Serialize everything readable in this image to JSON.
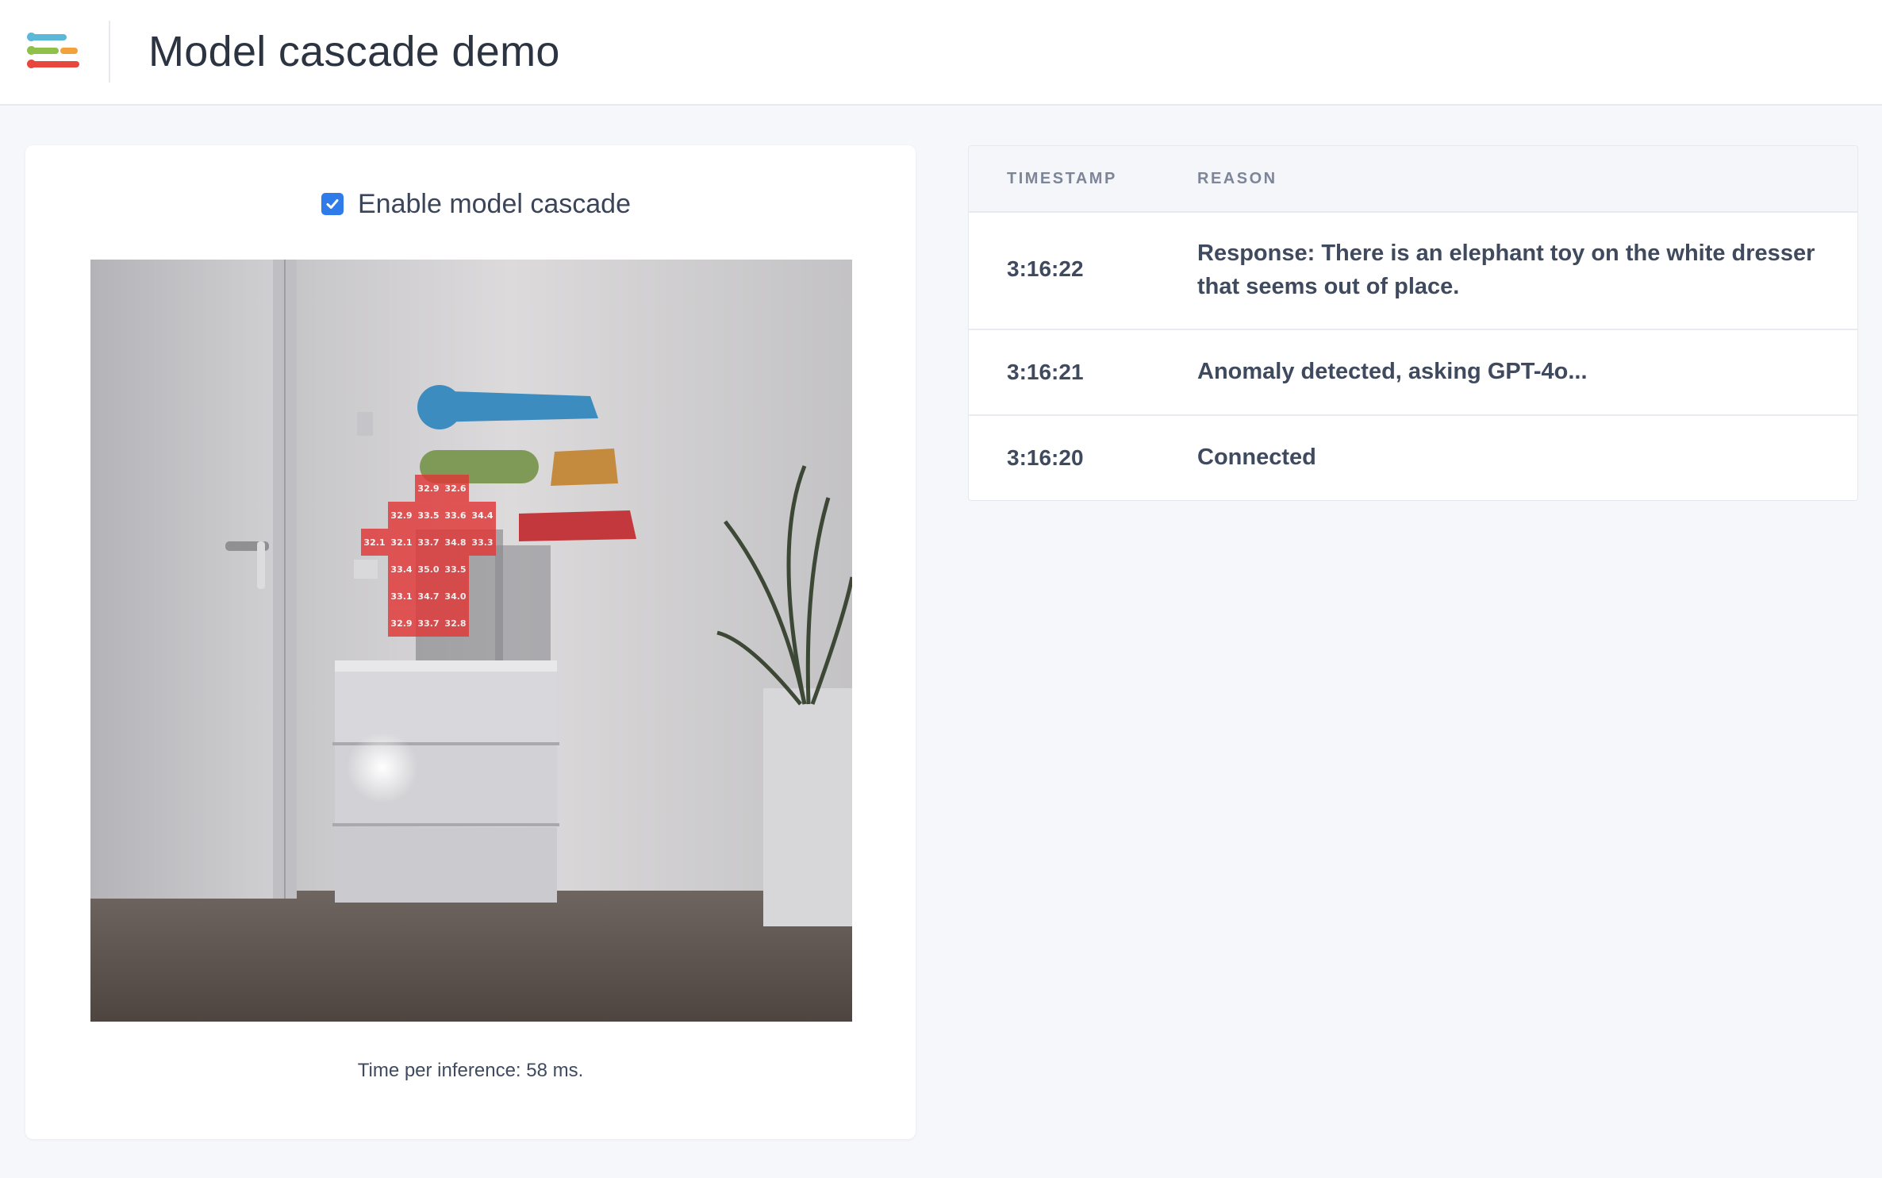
{
  "header": {
    "title": "Model cascade demo",
    "logo_icon": "stacked-bars-logo",
    "logo_colors": [
      "#5bb8d8",
      "#8fc04a",
      "#f2a23a",
      "#e8473d"
    ]
  },
  "controls": {
    "cascade_label": "Enable model cascade",
    "cascade_checked": true,
    "checkbox_color": "#2f7bea"
  },
  "camera": {
    "heatmap_values": [
      [
        "",
        "32.9",
        "32.6",
        ""
      ],
      [
        "32.9",
        "33.5",
        "33.6",
        "34.4"
      ],
      [
        "32.1",
        "32.1",
        "33.7",
        "34.8",
        "33.3"
      ],
      [
        "33.4",
        "35.0",
        "33.5"
      ],
      [
        "33.1",
        "34.7",
        "34.0"
      ],
      [
        "32.9",
        "33.7",
        "32.8"
      ]
    ],
    "heatmap_color": "#e13737"
  },
  "inference_text": "Time per inference: 58 ms.",
  "log": {
    "columns": {
      "timestamp": "TIMESTAMP",
      "reason": "REASON"
    },
    "rows": [
      {
        "timestamp": "3:16:22",
        "reason": "Response: There is an elephant toy on the white dresser that seems out of place."
      },
      {
        "timestamp": "3:16:21",
        "reason": "Anomaly detected, asking GPT-4o..."
      },
      {
        "timestamp": "3:16:20",
        "reason": "Connected"
      }
    ]
  }
}
